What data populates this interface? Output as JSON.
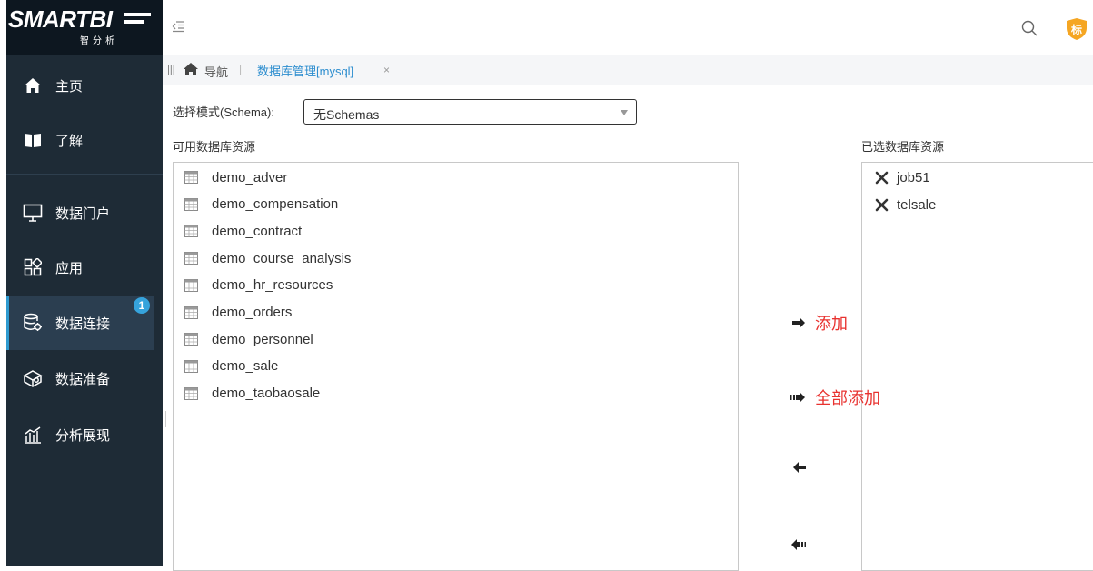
{
  "logo": {
    "brand": "SMARTBI",
    "subtitle": "智分析"
  },
  "sidebar": {
    "items": [
      {
        "label": "主页",
        "icon": "home-icon"
      },
      {
        "label": "了解",
        "icon": "book-icon"
      },
      {
        "label": "数据门户",
        "icon": "monitor-icon"
      },
      {
        "label": "应用",
        "icon": "apps-icon"
      },
      {
        "label": "数据连接",
        "icon": "database-connect-icon",
        "badge": "1",
        "active": true
      },
      {
        "label": "数据准备",
        "icon": "cube-icon"
      },
      {
        "label": "分析展现",
        "icon": "chart-icon"
      }
    ]
  },
  "topbar": {
    "avatar_char": "标"
  },
  "tabs": {
    "nav_label": "导航",
    "active_tab": "数据库管理[mysql]",
    "close": "×"
  },
  "schema": {
    "label": "选择模式(Schema):",
    "value": "无Schemas"
  },
  "available": {
    "title": "可用数据库资源",
    "items": [
      "demo_adver",
      "demo_compensation",
      "demo_contract",
      "demo_course_analysis",
      "demo_hr_resources",
      "demo_orders",
      "demo_personnel",
      "demo_sale",
      "demo_taobaosale"
    ]
  },
  "selected": {
    "title": "已选数据库资源",
    "items": [
      "job51",
      "telsale"
    ]
  },
  "actions": {
    "add": "添加",
    "add_all": "全部添加"
  },
  "colors": {
    "sidebar": "#1e2b36",
    "accent": "#2e8ecf",
    "action_label": "#e8322f",
    "avatar": "#f5a623"
  }
}
